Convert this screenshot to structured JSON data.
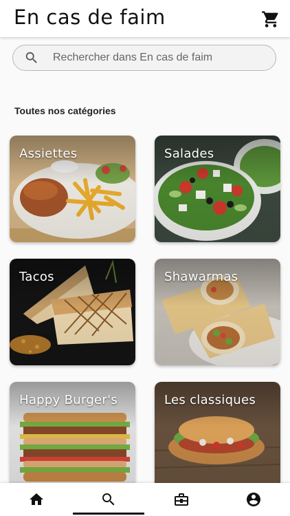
{
  "app": {
    "title": "En cas de faim",
    "cart_icon": "cart-icon"
  },
  "search": {
    "placeholder": "Rechercher dans En cas de faim",
    "icon": "search-icon"
  },
  "section": {
    "title": "Toutes nos catégories"
  },
  "categories": [
    {
      "label": "Assiettes"
    },
    {
      "label": "Salades"
    },
    {
      "label": "Tacos"
    },
    {
      "label": "Shawarmas"
    },
    {
      "label": "Happy Burger's"
    },
    {
      "label": "Les classiques"
    }
  ],
  "nav": [
    {
      "icon": "home-icon",
      "active": false
    },
    {
      "icon": "search-icon",
      "active": true
    },
    {
      "icon": "briefcase-icon",
      "active": false
    },
    {
      "icon": "account-icon",
      "active": false
    }
  ]
}
